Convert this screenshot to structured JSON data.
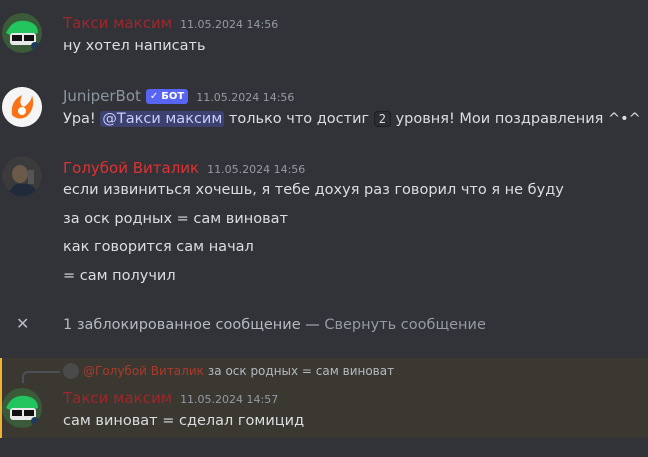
{
  "messages": [
    {
      "author": "Такси максим",
      "author_color": "#a0262a",
      "time": "11.05.2024 14:56",
      "lines": [
        "ну хотел написать"
      ]
    },
    {
      "author": "JuniperBot",
      "author_color": "#8d96a0",
      "badge": "БОТ",
      "time": "11.05.2024 14:56",
      "parts": {
        "a": "Ура! ",
        "mention": "@Такси максим",
        "b": " только что достиг ",
        "code": "2",
        "c": " уровня! Мои поздравления ^•^"
      }
    },
    {
      "author": "Голубой Виталик",
      "author_color": "#e03131",
      "time": "11.05.2024 14:56",
      "lines": [
        "если извиниться хочешь, я тебе дохуя раз говорил что я не буду",
        "за оск родных = сам виноват",
        "как говорится сам начал",
        "= сам получил"
      ]
    }
  ],
  "blocked": {
    "text": "1 заблокированное сообщение — ",
    "link": "Свернуть сообщение"
  },
  "reply_msg": {
    "reply_to_author": "@Голубой Виталик",
    "reply_to_author_color": "#c0392b",
    "reply_text": "за оск родных = сам виноват",
    "author": "Такси максим",
    "author_color": "#a0262a",
    "time": "11.05.2024 14:57",
    "text": "сам виноват = сделал гомицид"
  }
}
